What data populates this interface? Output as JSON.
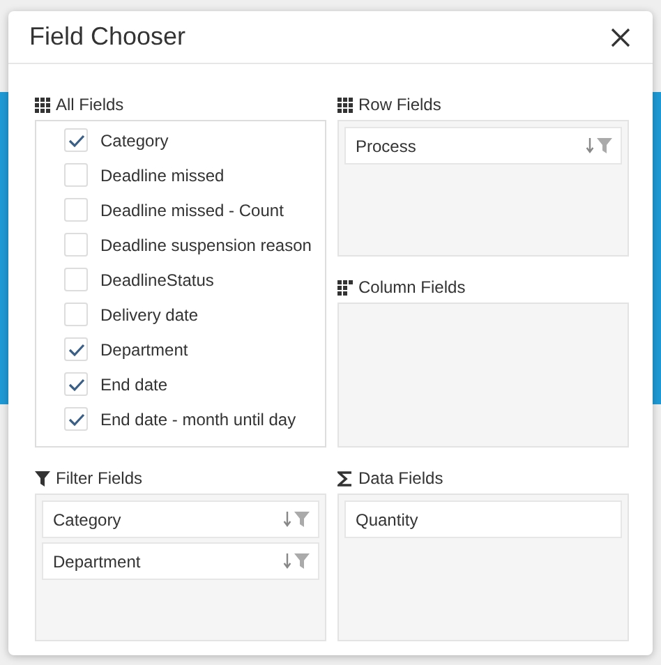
{
  "dialog": {
    "title": "Field Chooser"
  },
  "all_fields": {
    "label": "All Fields",
    "items": [
      {
        "label": "Category",
        "checked": true
      },
      {
        "label": "Deadline missed",
        "checked": false
      },
      {
        "label": "Deadline missed - Count",
        "checked": false
      },
      {
        "label": "Deadline suspension reason",
        "checked": false
      },
      {
        "label": "DeadlineStatus",
        "checked": false
      },
      {
        "label": "Delivery date",
        "checked": false
      },
      {
        "label": "Department",
        "checked": true
      },
      {
        "label": "End date",
        "checked": true
      },
      {
        "label": "End date - month until day",
        "checked": true
      }
    ]
  },
  "areas": [
    {
      "kind": "row",
      "label": "Row Fields",
      "fields": [
        {
          "label": "Process"
        }
      ]
    },
    {
      "kind": "column",
      "label": "Column Fields"
    },
    {
      "kind": "filter",
      "label": "Filter Fields",
      "fields": [
        {
          "label": "Category"
        },
        {
          "label": "Department"
        }
      ]
    },
    {
      "kind": "data",
      "label": "Data Fields",
      "fields": [
        {
          "label": "Quantity"
        }
      ]
    }
  ]
}
